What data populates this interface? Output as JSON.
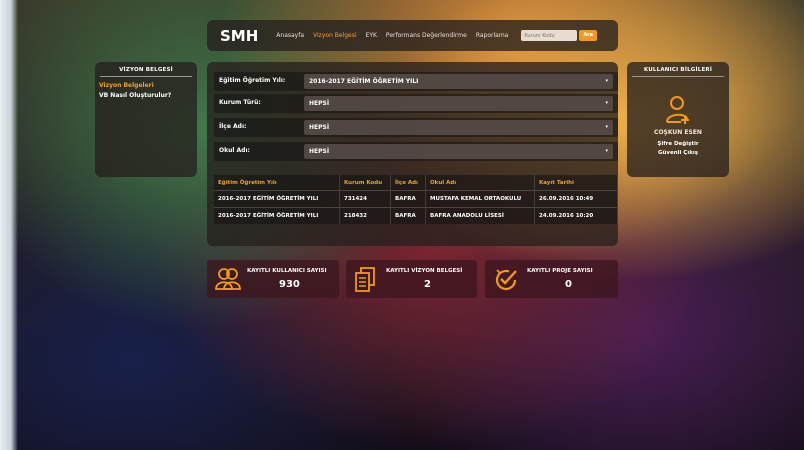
{
  "brand": {
    "logo": "SMH",
    "accent": "#f0a030"
  },
  "nav": {
    "items": [
      {
        "label": "Anasayfa",
        "active": false
      },
      {
        "label": "Vizyon Belgesi",
        "active": true
      },
      {
        "label": "EYK",
        "active": false
      },
      {
        "label": "Performans Değerlendirme",
        "active": false
      },
      {
        "label": "Raporlama",
        "active": false
      }
    ],
    "search": {
      "placeholder": "Kurum Kodu",
      "value": "",
      "button": "Ara"
    }
  },
  "left_panel": {
    "title": "VİZYON BELGESİ",
    "links": [
      {
        "label": "Vizyon Belgeleri",
        "active": true
      },
      {
        "label": "VB Nasıl Oluşturulur?",
        "active": false
      }
    ]
  },
  "right_panel": {
    "title": "KULLANICI BİLGİLERİ",
    "icon": "user-add-icon",
    "user_name": "COŞKUN ESEN",
    "links": [
      "Şifre Değiştir",
      "Güvenli Çıkış"
    ]
  },
  "form": {
    "rows": [
      {
        "label": "Eğitim Öğretim Yılı:",
        "value": "2016-2017 EĞİTİM ÖĞRETİM YILI"
      },
      {
        "label": "Kurum Türü:",
        "value": "HEPSİ"
      },
      {
        "label": "İlçe Adı:",
        "value": "HEPSİ"
      },
      {
        "label": "Okul Adı:",
        "value": "HEPSİ"
      }
    ]
  },
  "table": {
    "headers": [
      "Eğitim Öğretim Yılı",
      "Kurum Kodu",
      "İlçe Adı",
      "Okul Adı",
      "Kayıt Tarihi"
    ],
    "rows": [
      [
        "2016-2017 EĞİTİM ÖĞRETİM YILI",
        "731424",
        "BAFRA",
        "MUSTAFA KEMAL ORTAOKULU",
        "26.09.2016 10:49"
      ],
      [
        "2016-2017 EĞİTİM ÖĞRETİM YILI",
        "218432",
        "BAFRA",
        "BAFRA ANADOLU LİSESİ",
        "24.09.2016 10:20"
      ]
    ]
  },
  "stats": [
    {
      "icon": "users-icon",
      "label": "KAYITLI KULLANICI SAYISI",
      "value": "930"
    },
    {
      "icon": "documents-icon",
      "label": "KAYITLI VİZYON BELGESİ",
      "value": "2"
    },
    {
      "icon": "check-badge-icon",
      "label": "KAYITLI PROJE SAYISI",
      "value": "0"
    }
  ]
}
